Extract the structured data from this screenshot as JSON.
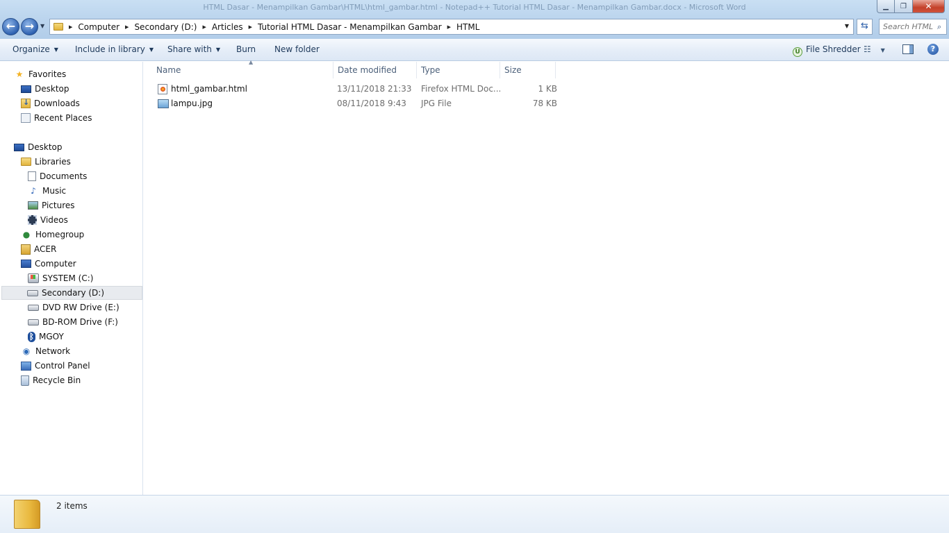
{
  "window": {
    "background_title": "HTML Dasar - Menampilkan Gambar\\HTML\\html_gambar.html - Notepad++  Tutorial HTML Dasar - Menampilkan Gambar.docx - Microsoft Word",
    "controls": {
      "minimize": "▁",
      "maximize": "❐",
      "close": "✕"
    }
  },
  "nav": {
    "back_glyph": "←",
    "forward_glyph": "→",
    "history_glyph": "▼"
  },
  "address": {
    "crumbs": [
      "Computer",
      "Secondary (D:)",
      "Articles",
      "Tutorial HTML Dasar - Menampilkan Gambar",
      "HTML"
    ],
    "separator": "▶",
    "dropdown_glyph": "▼",
    "refresh_glyph": "⇆"
  },
  "search": {
    "placeholder": "Search HTML",
    "icon": "⌕"
  },
  "toolbar": {
    "organize": "Organize",
    "include_in_library": "Include in library",
    "share_with": "Share with",
    "burn": "Burn",
    "new_folder": "New folder",
    "file_shredder": "File Shredder",
    "shredder_icon_letter": "U",
    "dropdown_glyph": "▼",
    "views_glyph": "☷",
    "help_glyph": "?"
  },
  "sidebar": {
    "favorites": {
      "label": "Favorites",
      "items": [
        "Desktop",
        "Downloads",
        "Recent Places"
      ]
    },
    "tree": {
      "desktop": "Desktop",
      "libraries": "Libraries",
      "library_items": [
        "Documents",
        "Music",
        "Pictures",
        "Videos"
      ],
      "homegroup": "Homegroup",
      "acer": "ACER",
      "computer": "Computer",
      "drives": [
        "SYSTEM (C:)",
        "Secondary (D:)",
        "DVD RW Drive (E:)",
        "BD-ROM Drive (F:)",
        "MGOY"
      ],
      "network": "Network",
      "control_panel": "Control Panel",
      "recycle_bin": "Recycle Bin"
    },
    "selected": "Secondary (D:)"
  },
  "columns": {
    "name": "Name",
    "date_modified": "Date modified",
    "type": "Type",
    "size": "Size",
    "sort_glyph": "▲"
  },
  "files": [
    {
      "name": "html_gambar.html",
      "date": "13/11/2018 21:33",
      "type": "Firefox HTML Doc...",
      "size": "1 KB",
      "icon": "firefox-html-icon"
    },
    {
      "name": "lampu.jpg",
      "date": "08/11/2018 9:43",
      "type": "JPG File",
      "size": "78 KB",
      "icon": "jpg-image-icon"
    }
  ],
  "details": {
    "item_count": "2 items"
  }
}
